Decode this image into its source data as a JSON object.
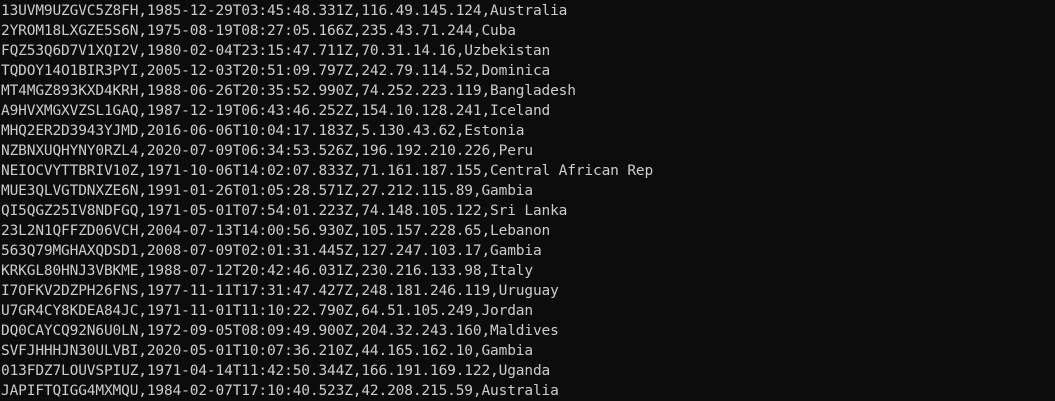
{
  "terminal": {
    "lines": [
      "13UVM9UZGVC5Z8FH,1985-12-29T03:45:48.331Z,116.49.145.124,Australia",
      "2YROM18LXGZE5S6N,1975-08-19T08:27:05.166Z,235.43.71.244,Cuba",
      "FQZ53Q6D7V1XQI2V,1980-02-04T23:15:47.711Z,70.31.14.16,Uzbekistan",
      "TQDOY14O1BIR3PYI,2005-12-03T20:51:09.797Z,242.79.114.52,Dominica",
      "MT4MGZ893KXD4KRH,1988-06-26T20:35:52.990Z,74.252.223.119,Bangladesh",
      "A9HVXMGXVZSL1GAQ,1987-12-19T06:43:46.252Z,154.10.128.241,Iceland",
      "MHQ2ER2D3943YJMD,2016-06-06T10:04:17.183Z,5.130.43.62,Estonia",
      "NZBNXUQHYNY0RZL4,2020-07-09T06:34:53.526Z,196.192.210.226,Peru",
      "NEIOCVYTTBRIV10Z,1971-10-06T14:02:07.833Z,71.161.187.155,Central African Rep",
      "MUE3QLVGTDNXZE6N,1991-01-26T01:05:28.571Z,27.212.115.89,Gambia",
      "QI5QGZ25IV8NDFGQ,1971-05-01T07:54:01.223Z,74.148.105.122,Sri Lanka",
      "23L2N1QFFZD06VCH,2004-07-13T14:00:56.930Z,105.157.228.65,Lebanon",
      "563Q79MGHAXQDSD1,2008-07-09T02:01:31.445Z,127.247.103.17,Gambia",
      "KRKGL80HNJ3VBKME,1988-07-12T20:42:46.031Z,230.216.133.98,Italy",
      "I7OFKV2DZPH26FNS,1977-11-11T17:31:47.427Z,248.181.246.119,Uruguay",
      "U7GR4CY8KDEA84JC,1971-11-01T11:10:22.790Z,64.51.105.249,Jordan",
      "DQ0CAYCQ92N6U0LN,1972-09-05T08:09:49.900Z,204.32.243.160,Maldives",
      "SVFJHHHJN30ULVBI,2020-05-01T10:07:36.210Z,44.165.162.10,Gambia",
      "013FDZ7LOUVSPIUZ,1971-04-14T11:42:50.344Z,166.191.169.122,Uganda",
      "JAPIFTQIGG4MXMQU,1984-02-07T17:10:40.523Z,42.208.215.59,Australia"
    ]
  }
}
